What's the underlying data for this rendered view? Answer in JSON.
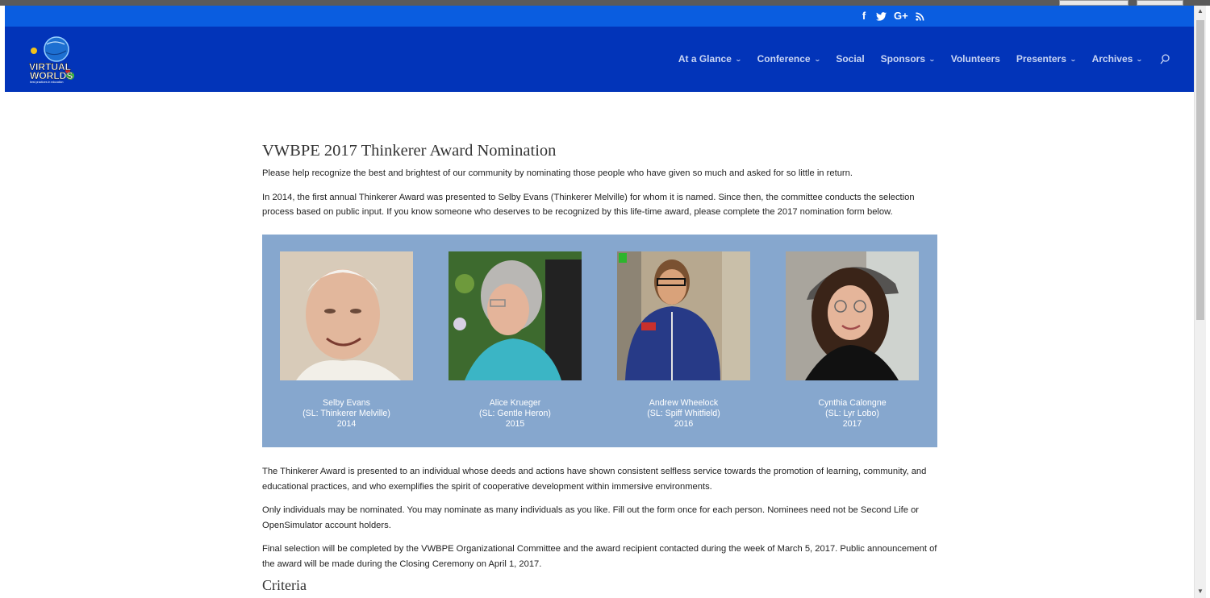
{
  "top_bar": {
    "social_icons": [
      "facebook-icon",
      "twitter-icon",
      "google-plus-icon",
      "rss-icon"
    ],
    "facebook_glyph": "f",
    "twitter_glyph": "t",
    "gplus_glyph": "G+",
    "color": "#0a5de0"
  },
  "header": {
    "logo_text": "VIRTUAL WORLDS",
    "logo_tagline": "best practices in education",
    "bg_color": "#0234b9",
    "nav": [
      {
        "label": "At a Glance",
        "dropdown": true
      },
      {
        "label": "Conference",
        "dropdown": true
      },
      {
        "label": "Social",
        "dropdown": false
      },
      {
        "label": "Sponsors",
        "dropdown": true
      },
      {
        "label": "Volunteers",
        "dropdown": false
      },
      {
        "label": "Presenters",
        "dropdown": true
      },
      {
        "label": "Archives",
        "dropdown": true
      }
    ],
    "search_icon": "search-icon"
  },
  "page": {
    "title": "VWBPE 2017 Thinkerer Award Nomination",
    "intro": "Please help recognize the best and brightest of our community by nominating those people who have given so much and asked for so little in return.",
    "history": "In 2014, the first annual Thinkerer Award was presented to Selby Evans (Thinkerer Melville) for whom it is named. Since then, the committee conducts the selection process based on public input. If you know someone who deserves to be recognized by this life-time award, please complete the 2017 nomination form below.",
    "recipients": [
      {
        "name": "Selby Evans",
        "sl": "(SL: Thinkerer Melville)",
        "year": "2014"
      },
      {
        "name": "Alice Krueger",
        "sl": "(SL: Gentle Heron)",
        "year": "2015"
      },
      {
        "name": "Andrew Wheelock",
        "sl": "(SL: Spiff Whitfield)",
        "year": "2016"
      },
      {
        "name": "Cynthia Calongne",
        "sl": "(SL: Lyr Lobo)",
        "year": "2017"
      }
    ],
    "panel_color": "#86a7ce",
    "description": "The Thinkerer Award is presented to an individual whose deeds and actions have shown consistent selfless service towards the promotion of learning, community, and educational practices, and who exemplifies the spirit of cooperative development within immersive environments.",
    "rules": "Only individuals may be nominated. You may nominate as many individuals as you like. Fill out the form once for each person. Nominees need not be Second Life or OpenSimulator account holders.",
    "selection": "Final selection will be completed by the VWBPE Organizational Committee and the award recipient contacted during the week of March 5, 2017. Public announcement of the award will be made during the Closing Ceremony on April 1, 2017.",
    "criteria_heading": "Criteria"
  }
}
